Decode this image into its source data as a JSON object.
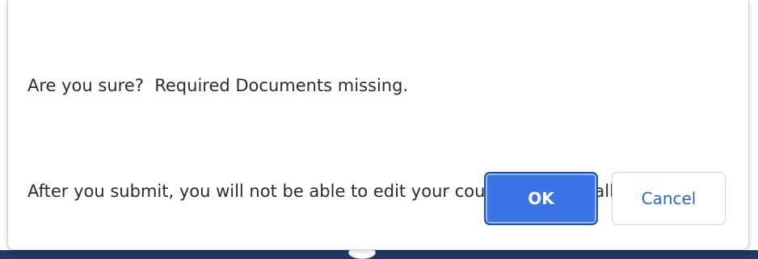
{
  "dialog": {
    "message_line1": "Are you sure?  Required Documents missing.",
    "message_line2": "After you submit, you will not be able to edit your course bids for Fall 2022.",
    "ok_label": "OK",
    "cancel_label": "Cancel"
  },
  "colors": {
    "ok_button_bg": "#3b74e6",
    "cancel_text": "#2c66d6",
    "page_bar": "#1f3864"
  }
}
